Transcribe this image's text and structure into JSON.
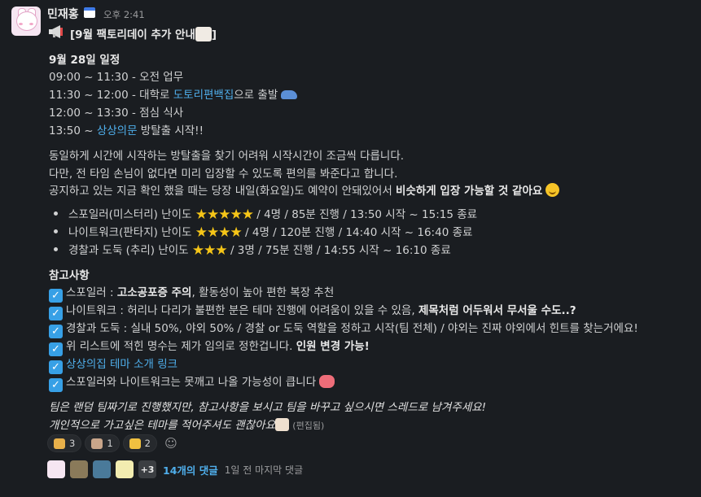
{
  "message": {
    "author": "민재홍",
    "time": "오후 2:41",
    "title_prefix": "[9월 팩토리데이 추가 안내",
    "title_suffix": "]",
    "schedule_heading": "9월 28일 일정",
    "schedule": [
      {
        "time": "09:00 ~ 11:30 - ",
        "text": "오전 업무"
      },
      {
        "time": "11:30 ~ 12:00 - ",
        "text_before": "대학로 ",
        "link": "도토리편백집",
        "text_after": "으로 출발"
      },
      {
        "time": "12:00 ~ 13:30 - ",
        "text": "점심 식사"
      },
      {
        "time": "13:50 ~  ",
        "link": "상상의문",
        "text_after": " 방탈출 시작!!"
      }
    ],
    "para1": "동일하게 시간에 시작하는 방탈출을 찾기 어려워 시작시간이 조금씩 다릅니다.",
    "para2": "다만, 전 타임 손님이 없다면 미리 입장할 수 있도록 편의를 봐준다고 합니다.",
    "para3_normal": "공지하고 있는 지금 확인 했을 때는 당장 내일(화요일)도 예약이 안돼있어서 ",
    "para3_bold": "비슷하게 입장 가능할 것 같아요",
    "themes": [
      {
        "name": "스포일러(미스터리) 난이도",
        "stars": "★★★★★",
        "info": "/ 4명 / 85분 진행 / 13:50 시작 ~ 15:15 종료"
      },
      {
        "name": "나이트워크(판타지) 난이도",
        "stars": "★★★★",
        "info": "/ 4명 / 120분 진행 / 14:40 시작 ~ 16:40 종료"
      },
      {
        "name": "경찰과 도둑 (추리) 난이도",
        "stars": "★★★",
        "info": "/ 3명 / 75분 진행 / 14:55 시작 ~ 16:10 종료"
      }
    ],
    "notes_heading": "참고사항",
    "notes": {
      "n1_a": "스포일러 : ",
      "n1_bold": "고소공포증 주의",
      "n1_b": ", 활동성이 높아 편한 복장 추천",
      "n2_a": "나이트워크 : 허리나 다리가 불편한 분은 테마 진행에 어려움이 있을 수 있음, ",
      "n2_bold": "제목처럼 어두워서 무서울 수도..?",
      "n3": "경찰과 도둑 : 실내 50%, 야외 50% / 경찰 or 도둑 역할을 정하고 시작(팀 전체) / 야외는 진짜 야외에서 힌트를 찾는거에요!",
      "n4_a": "위 리스트에 적힌 명수는 제가 임의로 정한겁니다. ",
      "n4_bold": "인원 변경 가능!",
      "n5_link": "상상의집 테마 소개 링크",
      "n6": "스포일러와 나이트워크는 못깨고 나올 가능성이 큽니다"
    },
    "closing1": "팀은 랜덤 팀짜기로 진행했지만, 참고사항을 보시고 팀을 바꾸고 싶으시면 스레드로 남겨주세요!",
    "closing2": "개인적으로 가고싶은 테마를 적어주셔도 괜찮아요",
    "edited": "(편집됨)",
    "check_mark": "✓"
  },
  "reactions": [
    {
      "emoji": "clap-emoji",
      "count": "3",
      "color": "#e8b04a"
    },
    {
      "emoji": "custom-image-emoji",
      "count": "1",
      "color": "#c8a58a"
    },
    {
      "emoji": "thumbs-up-emoji",
      "count": "2",
      "color": "#f0c040"
    }
  ],
  "add_reaction_icon": "add-reaction-icon",
  "thread": {
    "more_count": "+3",
    "reply_count": "14개의 댓글",
    "last_reply": "1일 전 마지막 댓글"
  }
}
